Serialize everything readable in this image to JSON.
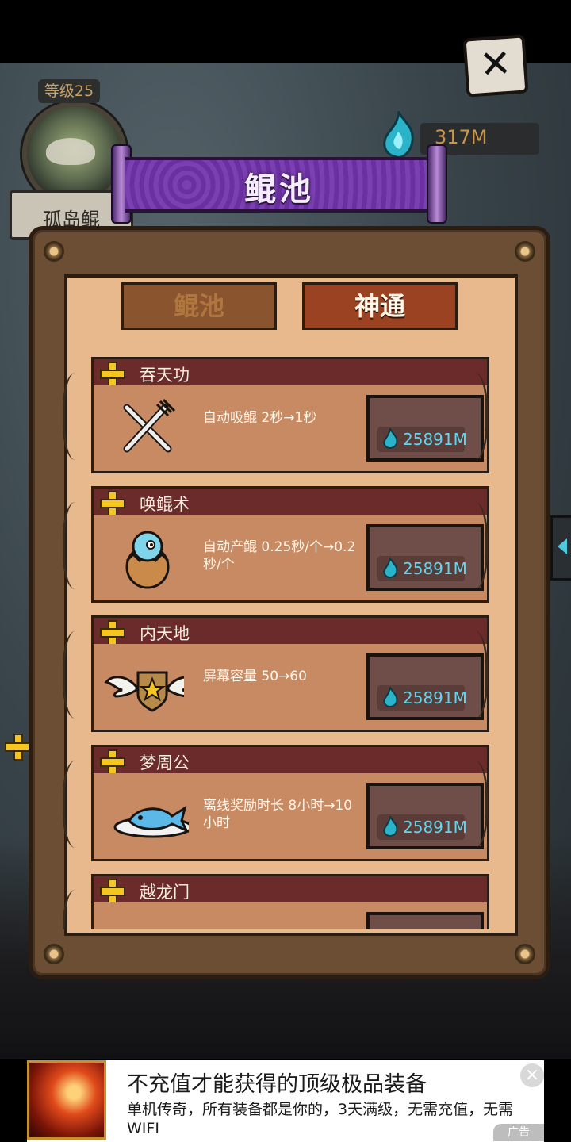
{
  "player": {
    "level_label": "等级25",
    "name": "孤岛鲲",
    "currency": "317M"
  },
  "banner": {
    "title": "鲲池"
  },
  "tabs": [
    {
      "label": "鲲池",
      "active": false
    },
    {
      "label": "神通",
      "active": true
    }
  ],
  "skills": [
    {
      "name": "吞天功",
      "description": "自动吸鲲 2秒→1秒",
      "price": "25891M",
      "icon": "fork-knife-icon"
    },
    {
      "name": "唤鲲术",
      "description": "自动产鲲 0.25秒/个→0.2秒/个",
      "price": "25891M",
      "icon": "egg-icon"
    },
    {
      "name": "内天地",
      "description": "屏幕容量 50→60",
      "price": "25891M",
      "icon": "winged-shield-icon"
    },
    {
      "name": "梦周公",
      "description": "离线奖励时长 8小时→10小时",
      "price": "25891M",
      "icon": "fish-plate-icon"
    },
    {
      "name": "越龙门",
      "description": "",
      "price": "",
      "icon": ""
    }
  ],
  "ad": {
    "title": "不充值才能获得的顶级极品装备",
    "description": "单机传奇，所有装备都是你的，3天满级，无需充值，无需WIFI",
    "tag": "广告",
    "close": "×"
  },
  "colors": {
    "panel": "#6b4e33",
    "panel_inner": "#e7b98c",
    "header": "#6a2b2a",
    "price_text": "#61d6f0",
    "banner": "#7a3fb0"
  }
}
